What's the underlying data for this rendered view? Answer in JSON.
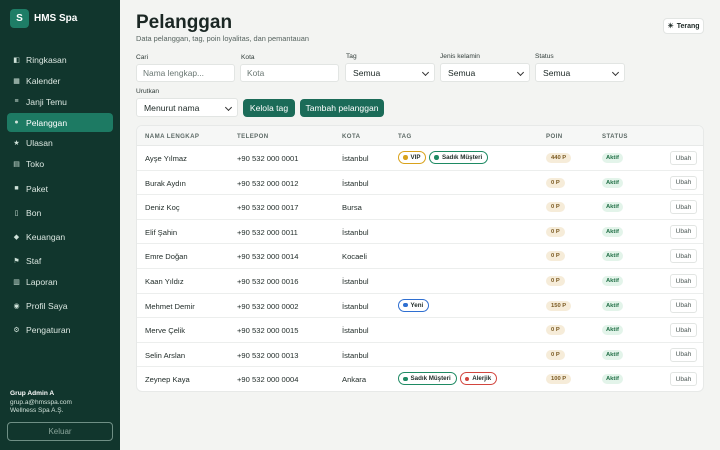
{
  "brand": {
    "logo_letter": "S",
    "name": "HMS Spa"
  },
  "nav": [
    {
      "label": "Ringkasan",
      "icon": "◧",
      "icon_name": "summary-icon",
      "active": false
    },
    {
      "label": "Kalender",
      "icon": "▦",
      "icon_name": "calendar-icon",
      "active": false
    },
    {
      "label": "Janji Temu",
      "icon": "≡",
      "icon_name": "appointments-icon",
      "active": false
    },
    {
      "label": "Pelanggan",
      "icon": "●",
      "icon_name": "customers-icon",
      "active": true
    },
    {
      "label": "Ulasan",
      "icon": "★",
      "icon_name": "star-icon",
      "active": false
    },
    {
      "label": "Toko",
      "icon": "▤",
      "icon_name": "shop-icon",
      "active": false
    },
    {
      "label": "Paket",
      "icon": "■",
      "icon_name": "package-icon",
      "active": false
    },
    {
      "label": "Bon",
      "icon": "▯",
      "icon_name": "receipt-icon",
      "active": false
    },
    {
      "label": "Keuangan",
      "icon": "◆",
      "icon_name": "finance-icon",
      "active": false
    },
    {
      "label": "Staf",
      "icon": "⚑",
      "icon_name": "staff-icon",
      "active": false
    },
    {
      "label": "Laporan",
      "icon": "▥",
      "icon_name": "report-icon",
      "active": false
    },
    {
      "label": "Profil Saya",
      "icon": "◉",
      "icon_name": "profile-icon",
      "active": false
    },
    {
      "label": "Pengaturan",
      "icon": "⚙",
      "icon_name": "settings-icon",
      "active": false
    }
  ],
  "user": {
    "name": "Grup Admin A",
    "email": "grup.a@hmsspa.com",
    "org": "Wellness Spa A.Ş.",
    "logout_label": "Keluar"
  },
  "page": {
    "title": "Pelanggan",
    "subtitle": "Data pelanggan, tag, poin loyalitas, dan pemantauan",
    "theme_label": "Terang"
  },
  "filters": {
    "search_label": "Cari",
    "search_placeholder": "Nama lengkap...",
    "city_label": "Kota",
    "city_placeholder": "Kota",
    "tag_label": "Tag",
    "tag_value": "Semua",
    "gender_label": "Jenis kelamin",
    "gender_value": "Semua",
    "status_label": "Status",
    "status_value": "Semua",
    "sort_label": "Urutkan",
    "sort_value": "Menurut nama",
    "manage_tags_label": "Kelola tag",
    "add_customer_label": "Tambah pelanggan"
  },
  "table": {
    "headers": [
      "NAMA LENGKAP",
      "TELEPON",
      "KOTA",
      "TAG",
      "POIN",
      "STATUS"
    ],
    "edit_label": "Ubah",
    "rows": [
      {
        "name": "Ayşe Yılmaz",
        "phone": "+90 532 000 0001",
        "city": "İstanbul",
        "tags": [
          {
            "label": "VIP",
            "color": "#d9a21b"
          },
          {
            "label": "Sadık Müşteri",
            "color": "#1e8a63"
          }
        ],
        "points": "440 P",
        "status": "Aktif"
      },
      {
        "name": "Burak Aydın",
        "phone": "+90 532 000 0012",
        "city": "İstanbul",
        "tags": [],
        "points": "0 P",
        "status": "Aktif"
      },
      {
        "name": "Deniz Koç",
        "phone": "+90 532 000 0017",
        "city": "Bursa",
        "tags": [],
        "points": "0 P",
        "status": "Aktif"
      },
      {
        "name": "Elif Şahin",
        "phone": "+90 532 000 0011",
        "city": "İstanbul",
        "tags": [],
        "points": "0 P",
        "status": "Aktif"
      },
      {
        "name": "Emre Doğan",
        "phone": "+90 532 000 0014",
        "city": "Kocaeli",
        "tags": [],
        "points": "0 P",
        "status": "Aktif"
      },
      {
        "name": "Kaan Yıldız",
        "phone": "+90 532 000 0016",
        "city": "İstanbul",
        "tags": [],
        "points": "0 P",
        "status": "Aktif"
      },
      {
        "name": "Mehmet Demir",
        "phone": "+90 532 000 0002",
        "city": "İstanbul",
        "tags": [
          {
            "label": "Yeni",
            "color": "#2f6fd1"
          }
        ],
        "points": "150 P",
        "status": "Aktif"
      },
      {
        "name": "Merve Çelik",
        "phone": "+90 532 000 0015",
        "city": "İstanbul",
        "tags": [],
        "points": "0 P",
        "status": "Aktif"
      },
      {
        "name": "Selin Arslan",
        "phone": "+90 532 000 0013",
        "city": "İstanbul",
        "tags": [],
        "points": "0 P",
        "status": "Aktif"
      },
      {
        "name": "Zeynep Kaya",
        "phone": "+90 532 000 0004",
        "city": "Ankara",
        "tags": [
          {
            "label": "Sadık Müşteri",
            "color": "#1e8a63"
          },
          {
            "label": "Alerjik",
            "color": "#d2453e"
          }
        ],
        "points": "100 P",
        "status": "Aktif"
      }
    ]
  }
}
